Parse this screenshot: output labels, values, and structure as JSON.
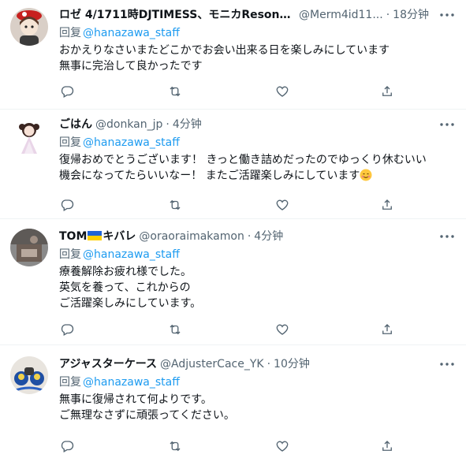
{
  "reply_prefix": "回复",
  "tweets": [
    {
      "name": "ロゼ 4/1711時DJTIMESS、モニカResonan...",
      "handle": "@Merm4id11...",
      "time": "18分钟",
      "reply_to": "@hanazawa_staff",
      "text": "おかえりなさいまたどこかでお会い出来る日を楽しみにしています\n無事に完治して良かったです"
    },
    {
      "name": "ごはん",
      "handle": "@donkan_jp",
      "time": "4分钟",
      "reply_to": "@hanazawa_staff",
      "text": "復帰おめでとうございます！ きっと働き詰めだったのでゆっくり休むいい\n機会になってたらいいなー！ またご活躍楽しみにしています",
      "emoji": "smiling-face-with-hearts"
    },
    {
      "name_prefix": "TOM",
      "name_suffix": "キバレ",
      "flag": "ukraine-flag",
      "handle": "@oraoraimakamon",
      "time": "4分钟",
      "reply_to": "@hanazawa_staff",
      "text": "療養解除お疲れ様でした。\n英気を養って、これからの\nご活躍楽しみにしています。"
    },
    {
      "name": "アジャスターケース",
      "handle": "@AdjusterCace_YK",
      "time": "10分钟",
      "reply_to": "@hanazawa_staff",
      "text": "無事に復帰されて何よりです。\nご無理なさずに頑張ってください。"
    }
  ],
  "icons": [
    "more-icon",
    "reply-icon",
    "retweet-icon",
    "like-icon",
    "share-icon"
  ]
}
